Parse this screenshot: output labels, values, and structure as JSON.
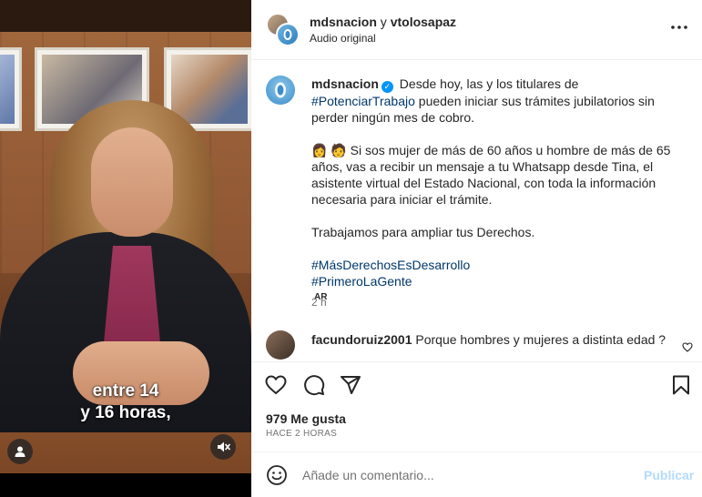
{
  "video": {
    "subtitle_line1": "entre 14",
    "subtitle_line2": "y 16 horas,",
    "user_icon": "person-icon",
    "mute_icon": "muted-speaker-icon"
  },
  "header": {
    "user1": "mdsnacion",
    "connector": "y",
    "user2": "vtolosapaz",
    "audio": "Audio original",
    "more_icon": "more-horizontal-icon"
  },
  "caption": {
    "username": "mdsnacion",
    "verified_icon": "verified-badge-icon",
    "p1_a": "Desde hoy, las y los titulares de",
    "p1_tag": "#PotenciarTrabajo",
    "p1_b": "pueden iniciar sus trámites jubilatorios sin perder ningún mes de cobro.",
    "p2_emojis": "👩 🧑",
    "p2": "Si sos mujer de más de 60 años u hombre de más de 65 años, vas a recibir un mensaje a tu Whatsapp desde Tina, el asistente virtual del Estado Nacional, con toda la información necesaria para iniciar el trámite.",
    "p3": "Trabajamos para ampliar tus Derechos.",
    "tag1": "#MásDerechosEsDesarrollo",
    "tag2": "#PrimeroLaGente",
    "flag": "AR",
    "time": "2 h"
  },
  "comment": {
    "username": "facundoruiz2001",
    "text": "Porque hombres y mujeres a distinta edad ?",
    "heart_icon": "heart-outline-icon"
  },
  "actions": {
    "like_icon": "heart-icon",
    "comment_icon": "comment-bubble-icon",
    "share_icon": "paper-plane-icon",
    "save_icon": "bookmark-icon"
  },
  "likes": "979 Me gusta",
  "posted_ago": "HACE 2 HORAS",
  "add_comment": {
    "placeholder": "Añade un comentario...",
    "publish_label": "Publicar",
    "emoji_icon": "smiley-icon"
  },
  "colors": {
    "link": "#00376b",
    "verified": "#0095f6",
    "publish_disabled": "#b3dbff",
    "muted_text": "#737373"
  }
}
